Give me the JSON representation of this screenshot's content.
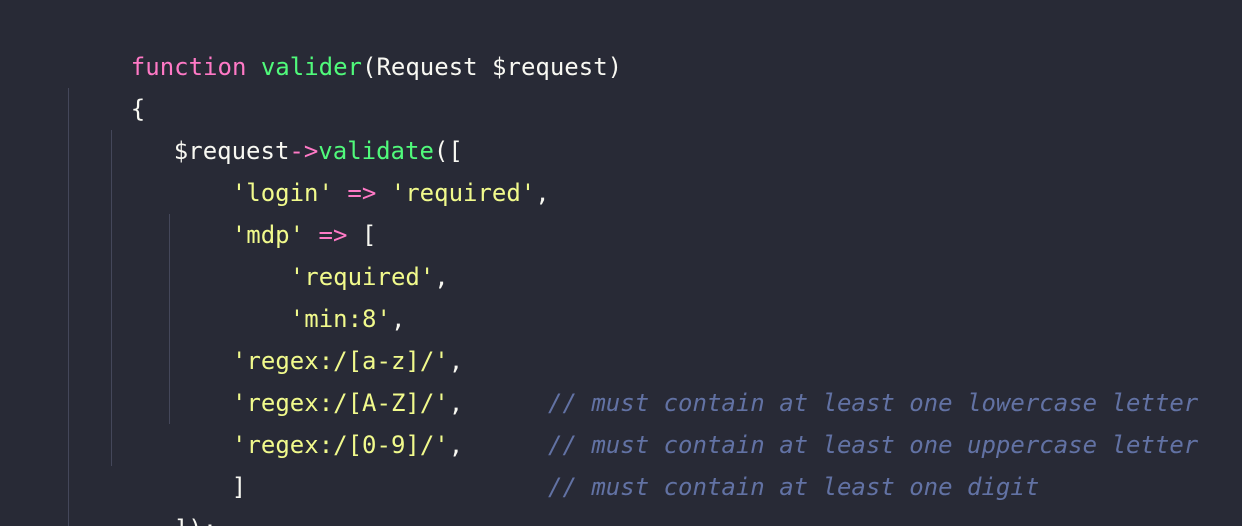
{
  "code": {
    "line1": {
      "keyword": "function",
      "name": "valider",
      "signature": "(Request $request)"
    },
    "line2": {
      "text": "{"
    },
    "line3": {
      "var": "$request",
      "arrow": "->",
      "method": "validate",
      "open": "(["
    },
    "line4": {
      "key": "'login'",
      "arrow": "=>",
      "value": "'required'",
      "comma": ","
    },
    "line5": {
      "key": "'mdp'",
      "arrow": "=>",
      "open": "["
    },
    "line6": {
      "value": "'required'",
      "comma": ","
    },
    "line7": {
      "value": "'min:8'",
      "comma": ","
    },
    "line8": {
      "value": "'regex:/[a-z]/'",
      "comma": ",",
      "comment": "// must contain at least one lowercase letter"
    },
    "line9": {
      "value": "'regex:/[A-Z]/'",
      "comma": ",",
      "comment": "// must contain at least one uppercase letter"
    },
    "line10": {
      "value": "'regex:/[0-9]/'",
      "comma": ",",
      "comment": "// must contain at least one digit"
    },
    "line11": {
      "text": "]"
    },
    "line12": {
      "text": "]);"
    }
  },
  "colors": {
    "background": "#282a36",
    "keyword": "#ff79c6",
    "function": "#50fa7b",
    "string": "#f1fa8c",
    "comment": "#6272a4",
    "text": "#f8f8f2",
    "indent_guide": "#44475a"
  }
}
